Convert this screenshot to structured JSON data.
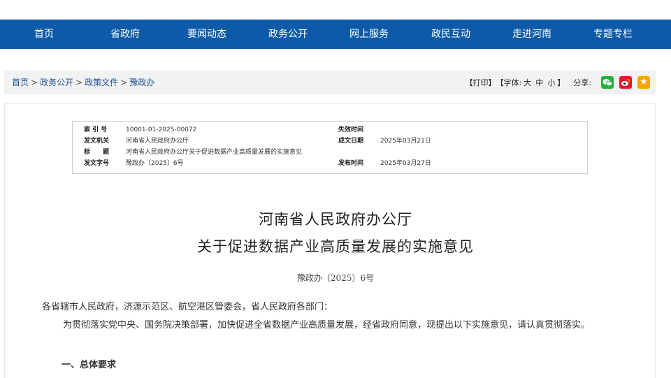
{
  "nav": {
    "items": [
      "首页",
      "省政府",
      "要闻动态",
      "政务公开",
      "网上服务",
      "政民互动",
      "走进河南",
      "专题专栏"
    ]
  },
  "breadcrumb": {
    "items": [
      "首页",
      "政务公开",
      "政策文件",
      "豫政办"
    ],
    "separator": ">"
  },
  "tools": {
    "print": "【打印】",
    "font_open": "【字体:",
    "font_large": "大",
    "font_medium": "中",
    "font_small": "小",
    "font_close": "】",
    "share_label": "分享:"
  },
  "meta": {
    "index_label": "索 引 号",
    "index_value": "10001-01-2025-00072",
    "effective_label": "失效时间",
    "effective_value": "",
    "issuer_label": "发文机关",
    "issuer_value": "河南省人民政府办公厅",
    "date_label": "成文日期",
    "date_value": "2025年03月21日",
    "title_label": "标　　题",
    "title_value": "河南省人民政府办公厅关于促进数据产业高质量发展的实施意见",
    "docno_label": "发文字号",
    "docno_value": "豫政办〔2025〕6号",
    "publish_label": "发布时间",
    "publish_value": "2025年03月27日"
  },
  "article": {
    "title_line1": "河南省人民政府办公厅",
    "title_line2": "关于促进数据产业高质量发展的实施意见",
    "doc_number": "豫政办〔2025〕6号",
    "salutation": "各省辖市人民政府，济源示范区、航空港区管委会，省人民政府各部门：",
    "para1": "为贯彻落实党中央、国务院决策部署，加快促进全省数据产业高质量发展，经省政府同意，现提出以下实施意见，请认真贯彻落实。",
    "heading1": "一、总体要求"
  },
  "colors": {
    "nav_bg": "#0d5aa8",
    "wechat": "#21b33a",
    "weibo": "#e6162d",
    "favorite": "#f6a500"
  }
}
